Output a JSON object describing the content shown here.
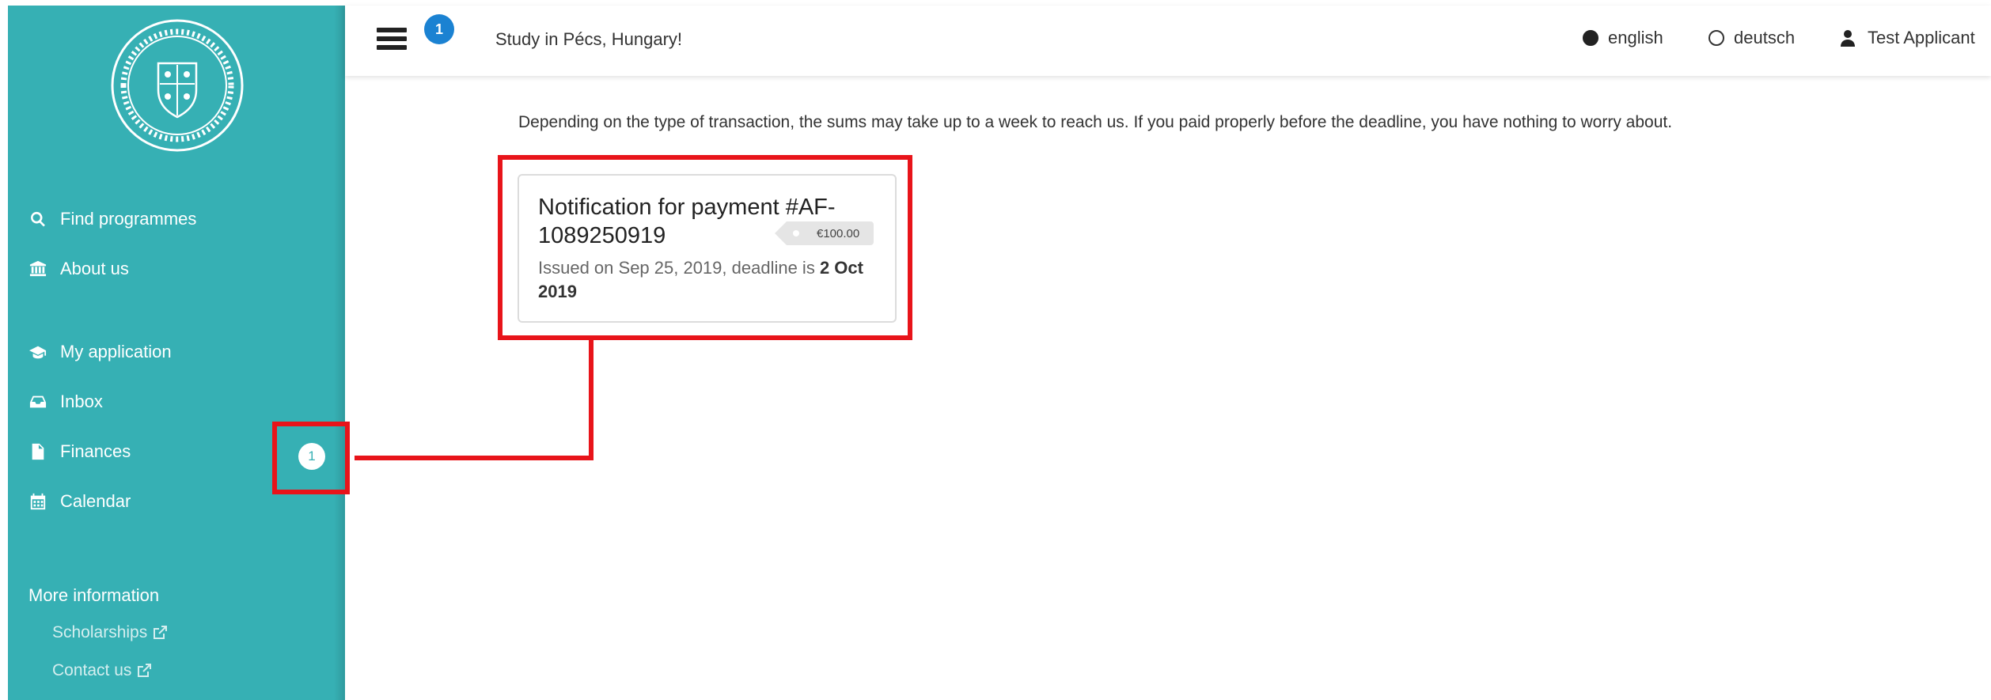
{
  "sidebar": {
    "nav": [
      {
        "label": "Find programmes",
        "icon": "search-icon"
      },
      {
        "label": "About us",
        "icon": "university-icon"
      },
      {
        "label": "My application",
        "icon": "graduation-cap-icon"
      },
      {
        "label": "Inbox",
        "icon": "inbox-icon"
      },
      {
        "label": "Finances",
        "icon": "file-icon",
        "badge": "1"
      },
      {
        "label": "Calendar",
        "icon": "calendar-icon"
      }
    ],
    "more_title": "More information",
    "links": [
      {
        "label": "Scholarships",
        "icon": "external-link-icon"
      },
      {
        "label": "Contact us",
        "icon": "external-link-icon"
      }
    ]
  },
  "header": {
    "menu_badge": "1",
    "site_title": "Study in Pécs, Hungary!",
    "languages": [
      {
        "label": "english",
        "selected": true
      },
      {
        "label": "deutsch",
        "selected": false
      }
    ],
    "user_name": "Test Applicant"
  },
  "main": {
    "notice": "Depending on the type of transaction, the sums may take up to a week to reach us. If you paid properly before the deadline, you have nothing to worry about.",
    "payment_card": {
      "title": "Notification for payment #AF-1089250919",
      "amount": "€100.00",
      "issued_text": "Issued on Sep 25, 2019, deadline is ",
      "deadline": "2 Oct 2019"
    }
  },
  "colors": {
    "sidebar": "#36b0b4",
    "badge_blue": "#1b82d2",
    "highlight_red": "#e8141a"
  }
}
